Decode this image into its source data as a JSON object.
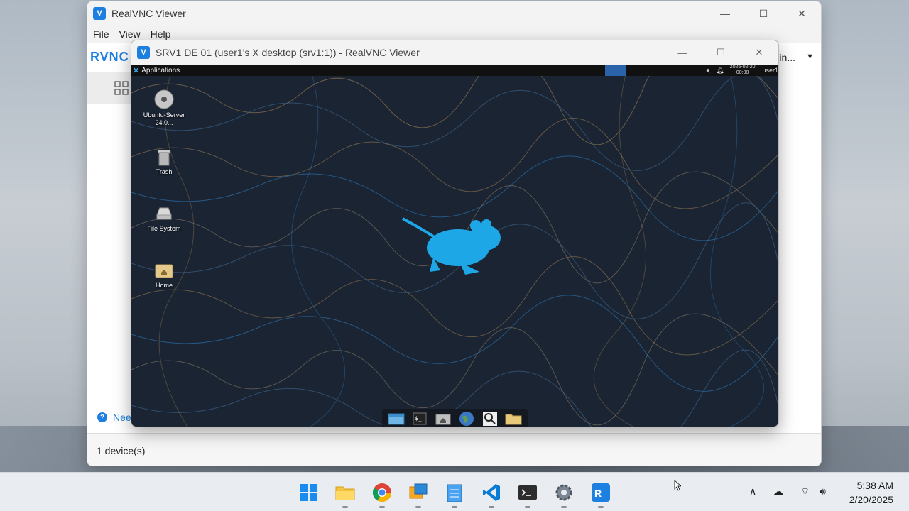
{
  "outer_window": {
    "title": "RealVNC Viewer",
    "menu": [
      "File",
      "View",
      "Help"
    ],
    "brand": "RVNC C",
    "signin_partial": "in...",
    "help_link": "Nee",
    "status": "1 device(s)"
  },
  "inner_window": {
    "title": "SRV1 DE 01 (user1's X desktop (srv1:1)) - RealVNC Viewer"
  },
  "remote_desktop": {
    "panel": {
      "applications_label": "Applications",
      "date": "2025-02-20",
      "time": "00:08",
      "user": "user1"
    },
    "icons": [
      {
        "label": "Ubuntu-Server 24.0..."
      },
      {
        "label": "Trash"
      },
      {
        "label": "File System"
      },
      {
        "label": "Home"
      }
    ],
    "dock": [
      "file-manager",
      "terminal",
      "home-folder",
      "web-browser",
      "search",
      "folder"
    ]
  },
  "taskbar": {
    "apps": [
      "windows-start",
      "file-explorer",
      "chrome",
      "remote-desktop",
      "notepad",
      "vscode",
      "terminal",
      "settings",
      "realvnc"
    ],
    "clock_time": "5:38 AM",
    "clock_date": "2/20/2025"
  },
  "colors": {
    "accent": "#1d7fe0",
    "remote_bg": "#1a2433",
    "xfce_blue": "#1ea7e6"
  }
}
